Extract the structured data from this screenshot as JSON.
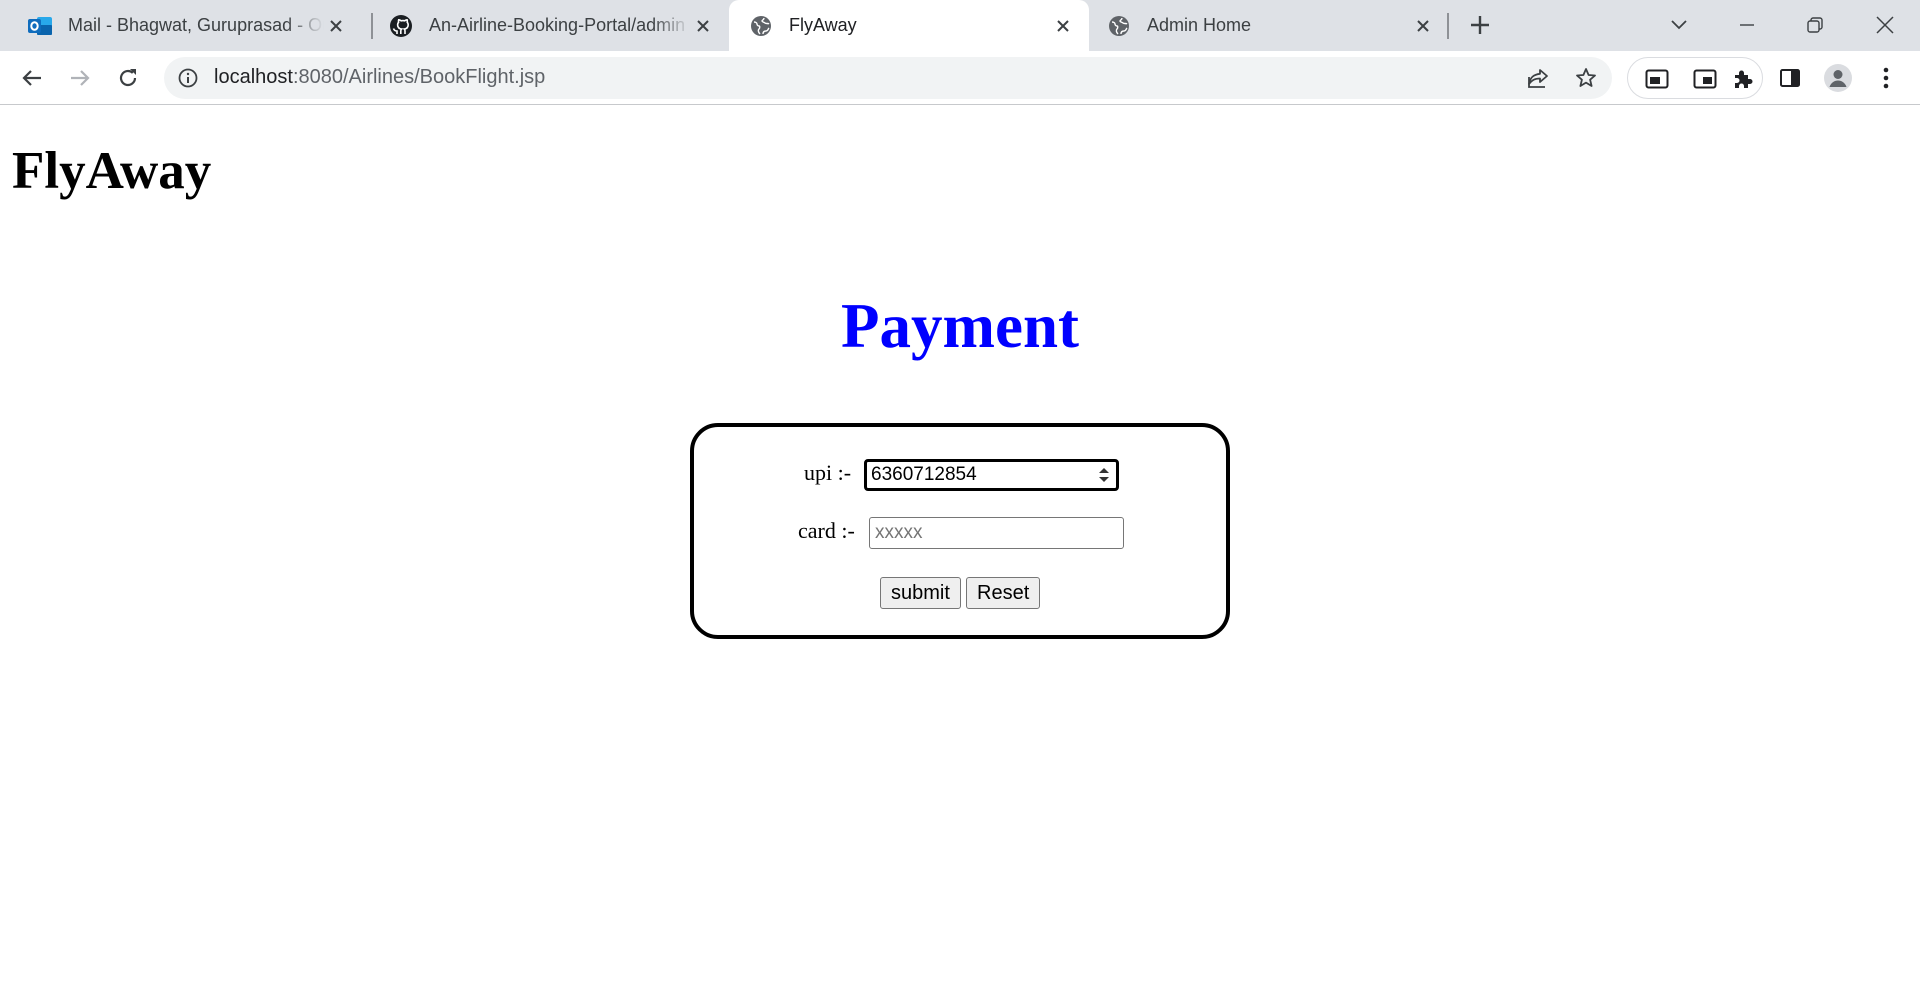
{
  "browser": {
    "tabs": [
      {
        "title": "Mail - Bhagwat, Guruprasad - Outlook",
        "icon": "outlook-icon",
        "active": false
      },
      {
        "title": "An-Airline-Booking-Portal/admin",
        "icon": "github-icon",
        "active": false
      },
      {
        "title": "FlyAway",
        "icon": "globe-icon",
        "active": true
      },
      {
        "title": "Admin Home",
        "icon": "globe-icon",
        "active": false
      }
    ],
    "url_host": "localhost",
    "url_path": ":8080/Airlines/BookFlight.jsp"
  },
  "page": {
    "brand": "FlyAway",
    "heading": "Payment",
    "heading_color": "#0000ff",
    "form": {
      "upi_label": "upi :-",
      "upi_value": "6360712854",
      "card_label": "card :-",
      "card_placeholder": "xxxxx",
      "submit_label": "submit",
      "reset_label": "Reset"
    }
  }
}
